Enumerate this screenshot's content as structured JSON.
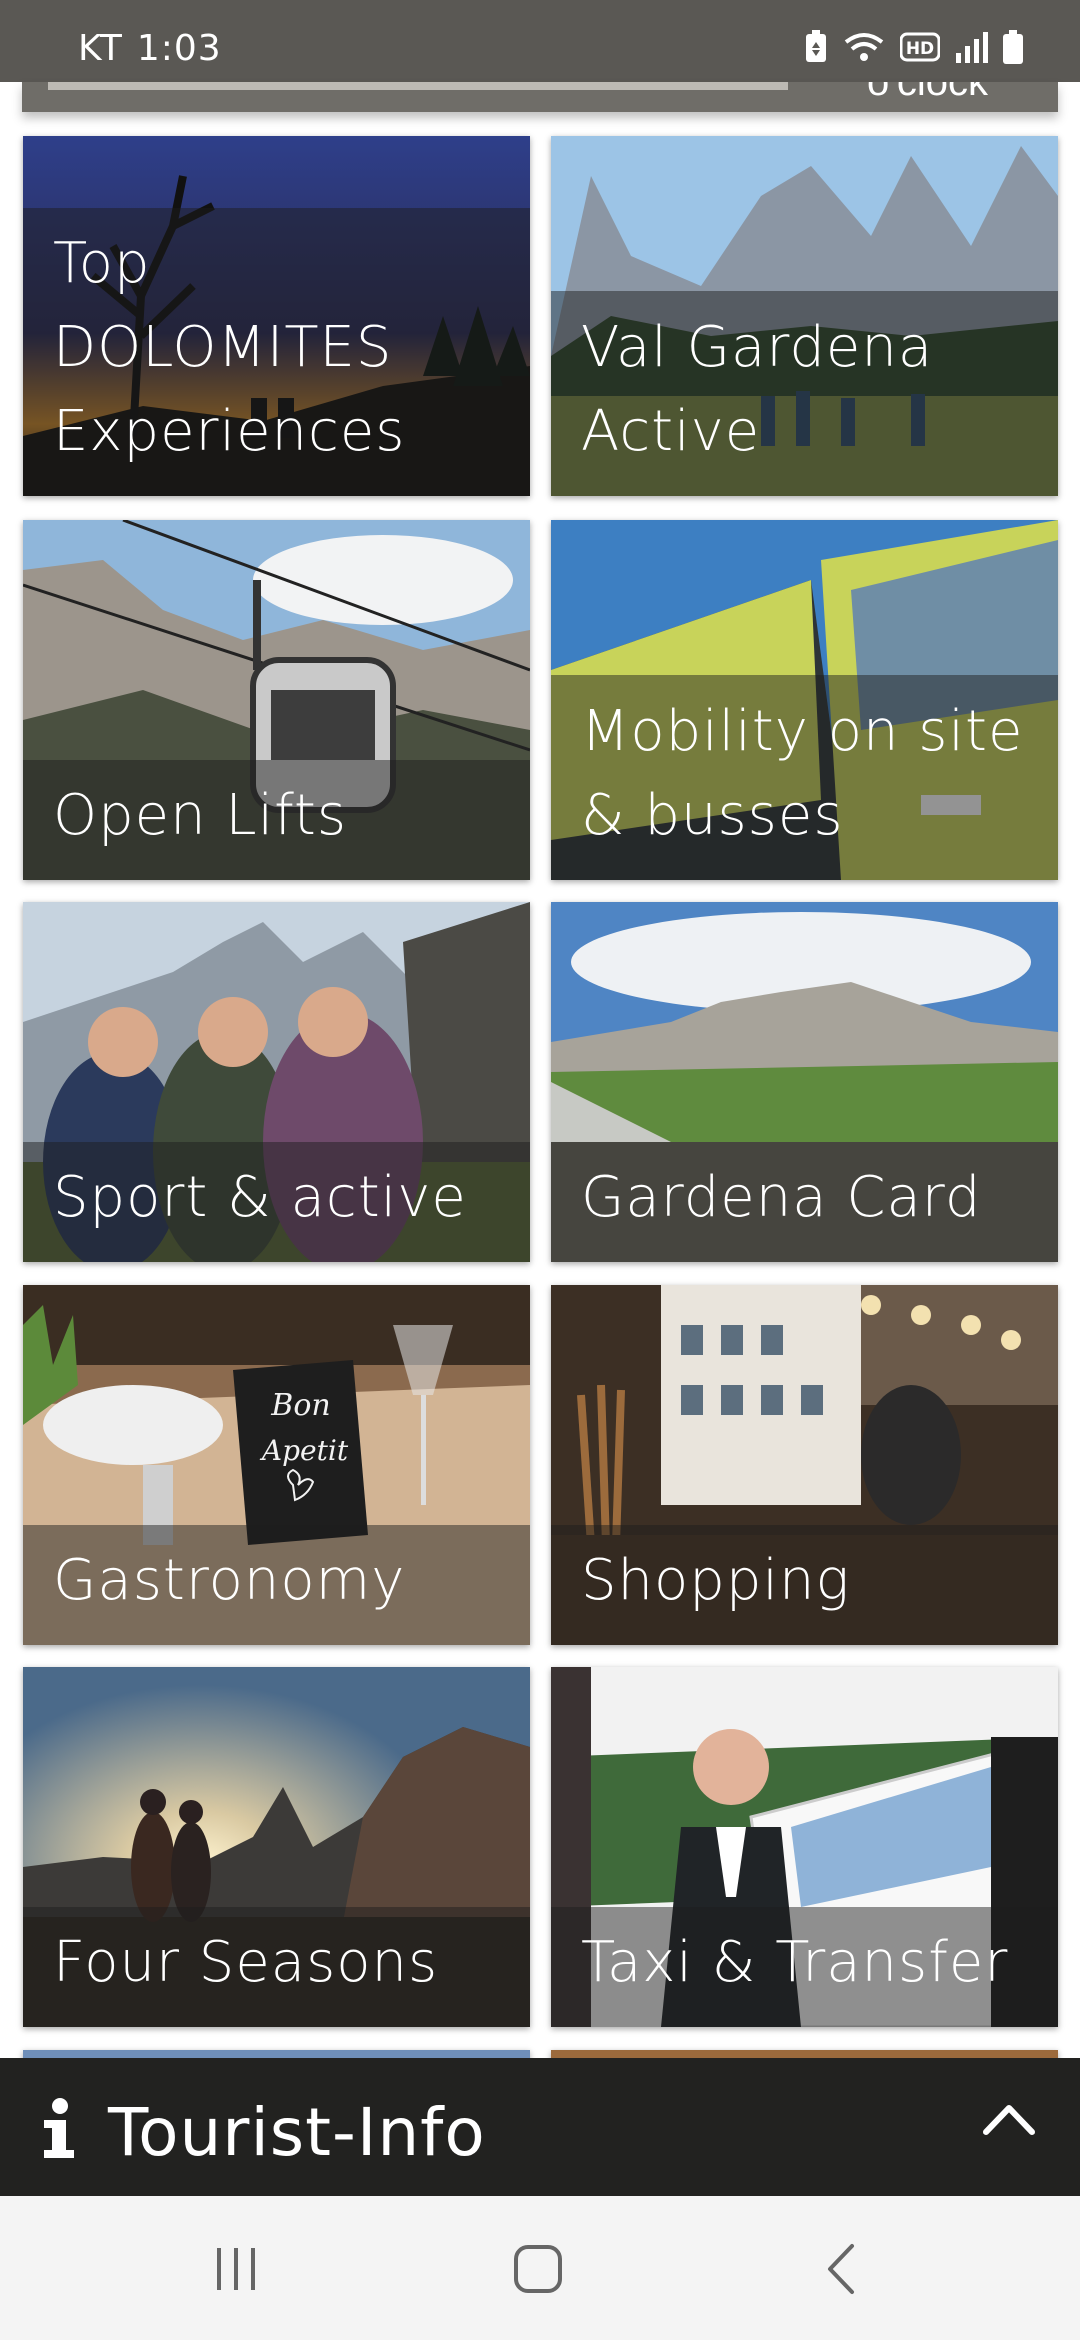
{
  "status_bar": {
    "carrier": "KT",
    "time": "1:03",
    "icons": [
      "battery-saver-icon",
      "wifi-icon",
      "hd-icon",
      "signal-icon",
      "battery-icon"
    ]
  },
  "header": {
    "partial_text": "o'clock"
  },
  "tiles": [
    {
      "label": "Top\nDOLOMITES\nExperiences",
      "image": "silhouette-tree-sunset"
    },
    {
      "label": "Val Gardena\nActive",
      "image": "mountain-hikers"
    },
    {
      "label": "Open Lifts",
      "image": "gondola-lift"
    },
    {
      "label": "Mobility on site\n& busses",
      "image": "buses"
    },
    {
      "label": "Sport & active",
      "image": "friends-selfie"
    },
    {
      "label": "Gardena Card",
      "image": "mountain-valley"
    },
    {
      "label": "Gastronomy",
      "image": "bon-apetit-table"
    },
    {
      "label": "Shopping",
      "image": "shop-street"
    },
    {
      "label": "Four Seasons",
      "image": "couple-mountain-sunrise"
    },
    {
      "label": "Taxi & Transfer",
      "image": "chauffeur-van"
    }
  ],
  "tourist_info": {
    "title": "Tourist-Info",
    "icon": "info-icon",
    "toggle_icon": "chevron-up-icon"
  },
  "nav": {
    "icons": [
      "recent-apps-icon",
      "home-icon",
      "back-icon"
    ]
  },
  "colors": {
    "status_bar": "#5a5854",
    "tourist_bar": "#222220",
    "nav_bar": "#f4f4f4"
  }
}
